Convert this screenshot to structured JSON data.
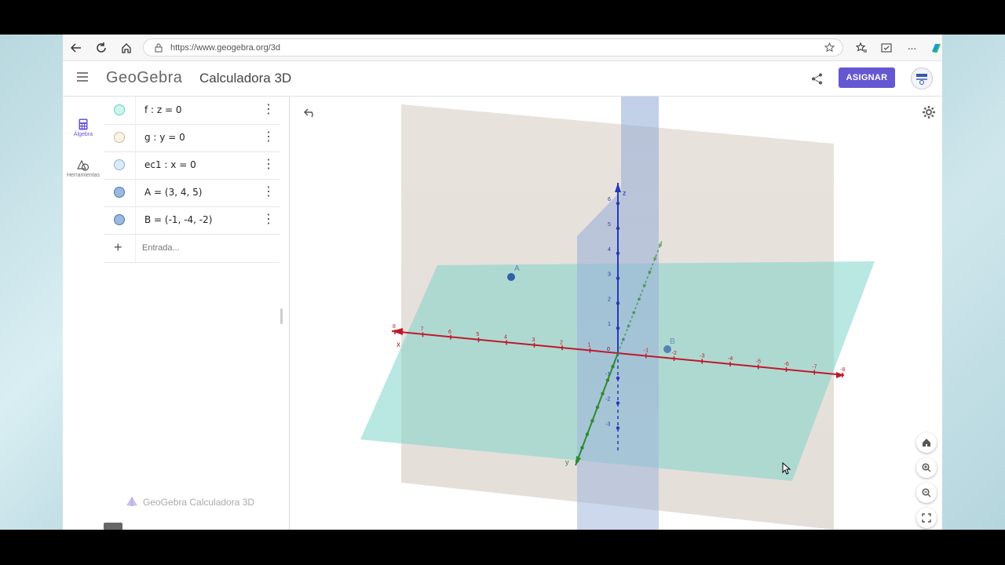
{
  "browser": {
    "url_host": "https://www.geogebra.org",
    "url_path": "/3d"
  },
  "app": {
    "logo": "GeoGebra",
    "title": "Calculadora 3D",
    "assign_label": "ASIGNAR"
  },
  "sidebar": {
    "items": [
      {
        "label": "Álgebra",
        "icon": "calculator-icon",
        "active": true
      },
      {
        "label": "Herramientas",
        "icon": "shapes-icon",
        "active": false
      }
    ]
  },
  "algebra": {
    "rows": [
      {
        "expr": "f : z = 0",
        "color": "#5ed6c6"
      },
      {
        "expr": "g : y = 0",
        "color": "#d9b98a"
      },
      {
        "expr": "ec1 : x = 0",
        "color": "#a9c9e8"
      },
      {
        "expr": "A = (3, 4, 5)",
        "color": "#4a78b8"
      },
      {
        "expr": "B = (-1, -4, -2)",
        "color": "#4a78b8"
      }
    ],
    "input_placeholder": "Entrada...",
    "footer": "GeoGebra Calculadora 3D"
  },
  "graphics": {
    "x_axis_label": "x",
    "y_axis_label": "y",
    "z_axis_label": "z",
    "point_a_label": "A",
    "point_b_label": "B",
    "x_ticks_left": [
      "8",
      "7",
      "6",
      "5",
      "4",
      "3",
      "2",
      "1"
    ],
    "x_ticks_right": [
      "-1",
      "-2",
      "-3",
      "-4",
      "-5",
      "-6",
      "-7",
      "-8"
    ],
    "z_ticks": [
      "6",
      "5",
      "4",
      "3",
      "2",
      "1"
    ],
    "z_ticks_neg": [
      "-1",
      "-2",
      "-3"
    ],
    "origin_label": "0",
    "colors": {
      "x_axis": "#c0182b",
      "y_axis": "#2e8a2e",
      "z_axis": "#2638b8",
      "plane_xy": "#7fd3c8",
      "plane_xz": "#d6c7b8",
      "plane_yz": "#9fb4d6",
      "point": "#2f5fa8"
    }
  }
}
